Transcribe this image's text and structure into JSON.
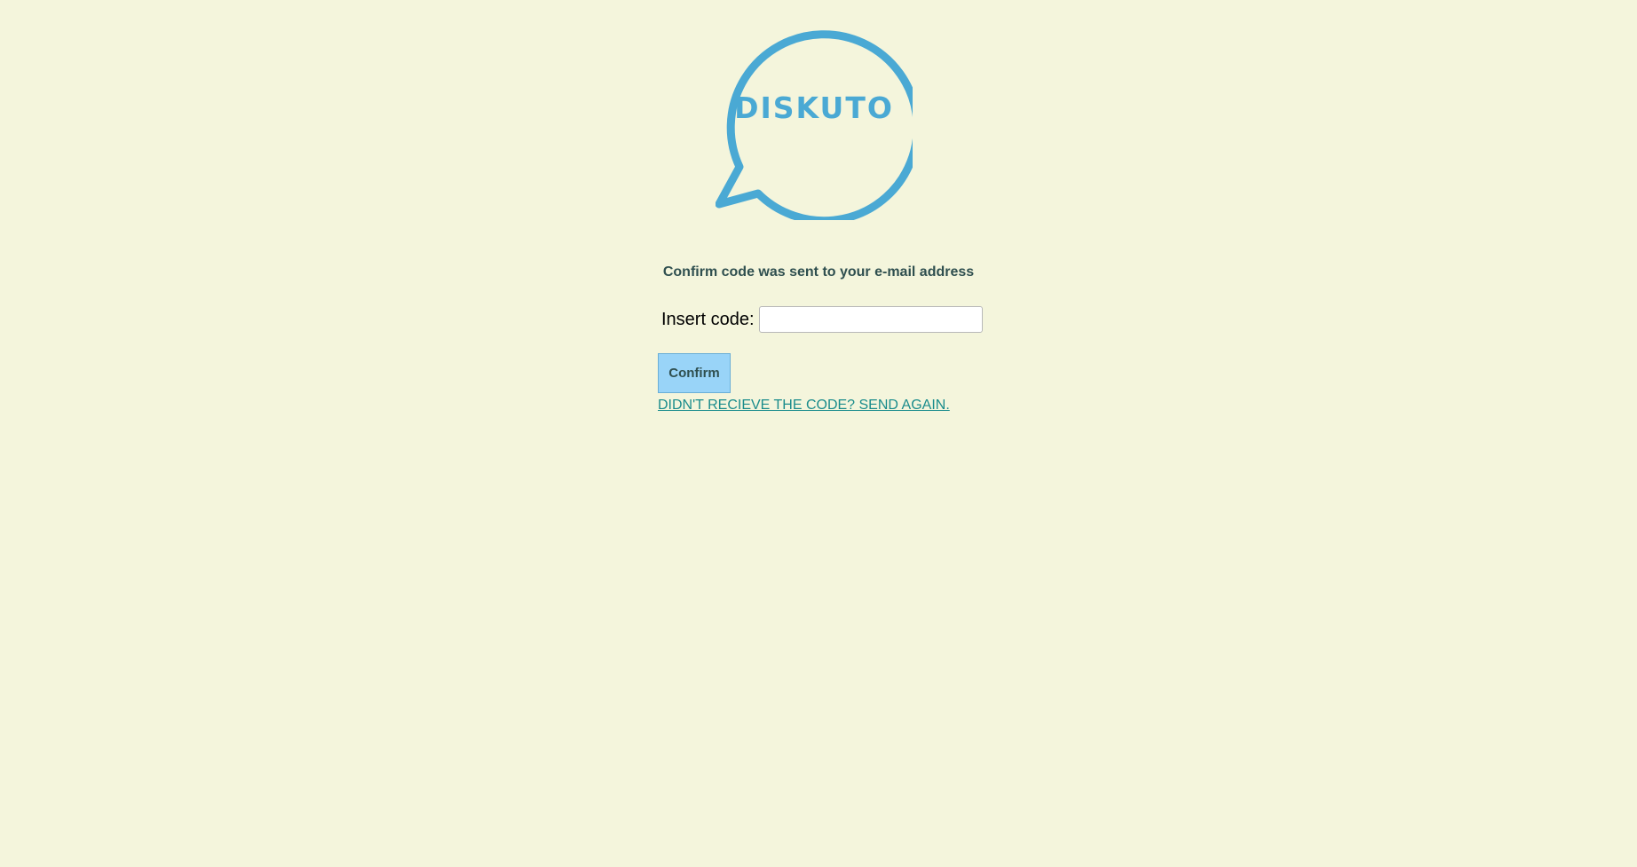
{
  "logo": {
    "text": "DISKUTO",
    "icon": "speech-bubble-icon",
    "color": "#4aa9d4"
  },
  "confirm_form": {
    "message": "Confirm code was sent to your e-mail address",
    "code_label": "Insert code:",
    "code_value": "",
    "code_placeholder": "",
    "confirm_label": "Confirm",
    "resend_link": "DIDN'T RECIEVE THE CODE? SEND AGAIN."
  },
  "colors": {
    "background": "#f4f5dc",
    "button": "#99d4f8",
    "link": "#1a8c8c",
    "heading": "#2f4f4f"
  }
}
